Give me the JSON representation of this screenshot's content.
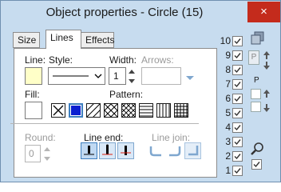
{
  "window": {
    "title": "Object properties - Circle (15)",
    "close_glyph": "×"
  },
  "tabs": [
    {
      "label": "Size",
      "active": false
    },
    {
      "label": "Lines",
      "active": true
    },
    {
      "label": "Effects",
      "active": false
    }
  ],
  "lines": {
    "line_label": "Line:",
    "style_label": "Style:",
    "width_label": "Width:",
    "width_value": "1",
    "arrows_label": "Arrows:",
    "fill_label": "Fill:",
    "pattern_label": "Pattern:",
    "round_label": "Round:",
    "round_value": "0",
    "line_end_label": "Line end:",
    "line_join_label": "Line join:",
    "line_color": "#ffffc8",
    "fill_color": "#ffffff",
    "selected_pattern": "solid-fill"
  },
  "patterns": [
    "none-pattern",
    "solid-fill",
    "diagonal-up",
    "diagonal-cross",
    "hatch-cross",
    "vertical-lines",
    "grid"
  ],
  "line_ends": [
    "flat-end",
    "round-end",
    "square-end"
  ],
  "line_joins": [
    "round-join",
    "round-join-2",
    "miter-join"
  ],
  "rows": [
    "10",
    "9",
    "8",
    "7",
    "6",
    "5",
    "4",
    "3",
    "2",
    "1"
  ],
  "colors": {
    "accent": "#3e7fbf",
    "window_bg": "#c7dcef",
    "close": "#c42b1c"
  }
}
